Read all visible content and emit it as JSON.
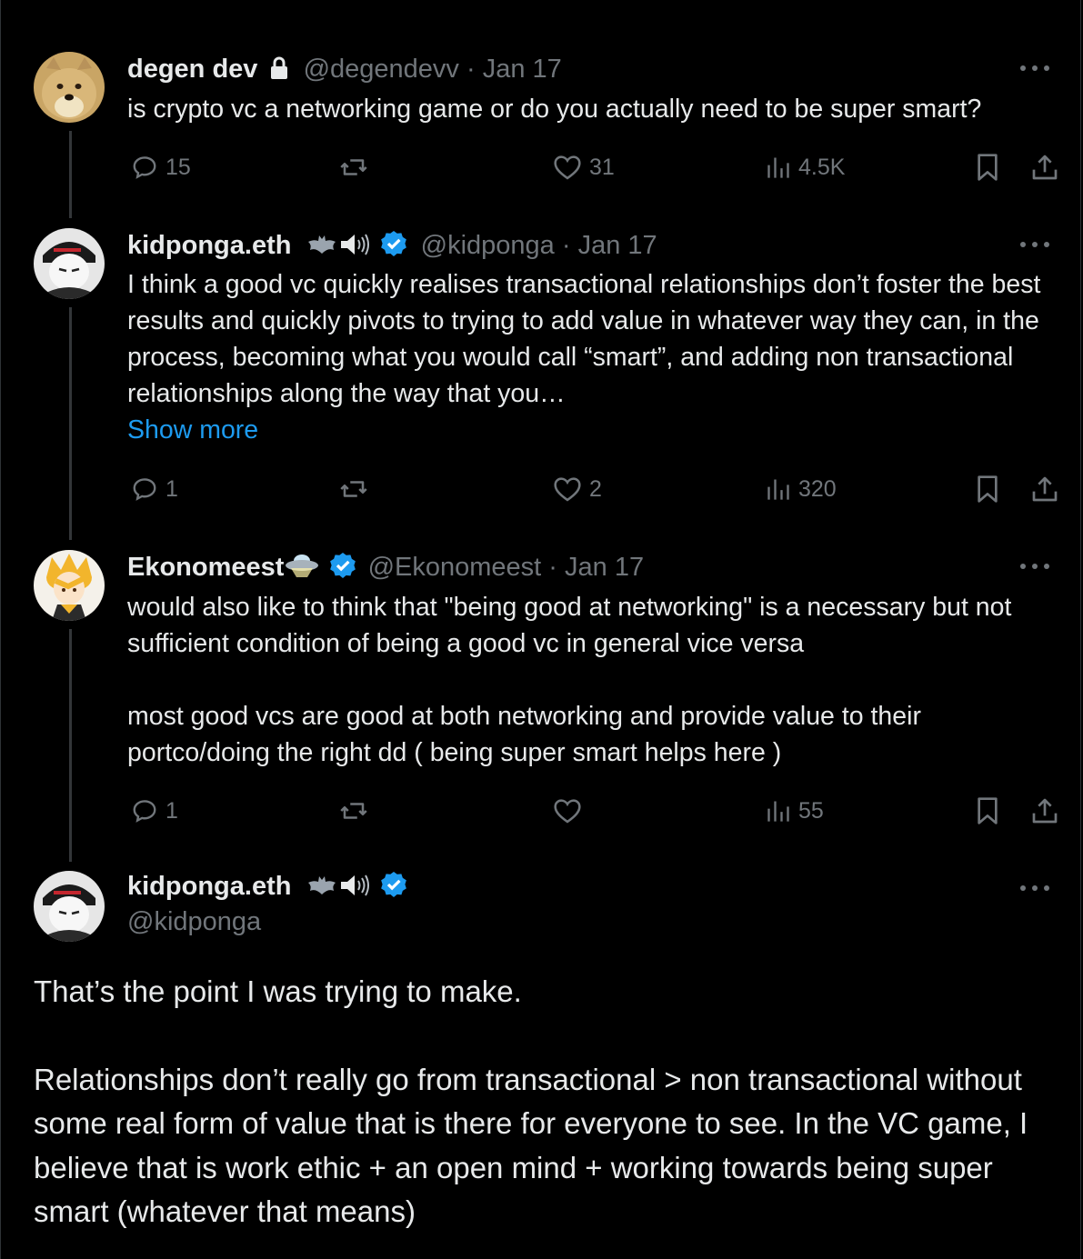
{
  "tweets": [
    {
      "name": "degen dev",
      "handle": "@degendevv",
      "separator": " · ",
      "date": "Jan 17",
      "text": "is crypto vc a networking game or do you actually need to be super smart?",
      "replies": "15",
      "reposts": "",
      "likes": "31",
      "views": "4.5K",
      "icons": [
        "lock-icon"
      ]
    },
    {
      "name": "kidponga.eth",
      "handle": "@kidponga",
      "separator": " · ",
      "date": "Jan 17",
      "text": "I think a good vc quickly realises transactional relationships don’t foster the best results and quickly pivots to trying to add value in whatever way they can, in the process, becoming what you would call “smart”, and adding non transactional relationships along the way that you…",
      "show_more": "Show more",
      "replies": "1",
      "reposts": "",
      "likes": "2",
      "views": "320",
      "icons": [
        "bat-emoji-icon",
        "speaker-emoji-icon",
        "verified-badge-icon"
      ]
    },
    {
      "name": "Ekonomeest",
      "handle": "@Ekonomeest",
      "separator": " · ",
      "date": "Jan 17",
      "text_p1": "would also like to think that \"being good at networking\" is a necessary but not sufficient condition of being a good vc in general vice versa",
      "text_p2": "most good vcs are good at both networking and provide value to their portco/doing the right dd ( being super smart helps here )",
      "replies": "1",
      "reposts": "",
      "likes": "",
      "views": "55",
      "icons": [
        "ufo-emoji-icon",
        "verified-badge-icon"
      ]
    }
  ],
  "main_tweet": {
    "name": "kidponga.eth",
    "handle": "@kidponga",
    "text_p1": "That’s the point I was trying to make.",
    "text_p2": "Relationships don’t really go from transactional > non transactional without some real form of value that is there for everyone to see. In the VC game, I believe that is work ethic + an open mind + working towards being super smart (whatever that means)"
  },
  "colors": {
    "background": "#000000",
    "text": "#e7e9ea",
    "muted": "#71767b",
    "link": "#1d9bf0",
    "verified": "#1d9bf0",
    "thread_line": "#333639"
  }
}
